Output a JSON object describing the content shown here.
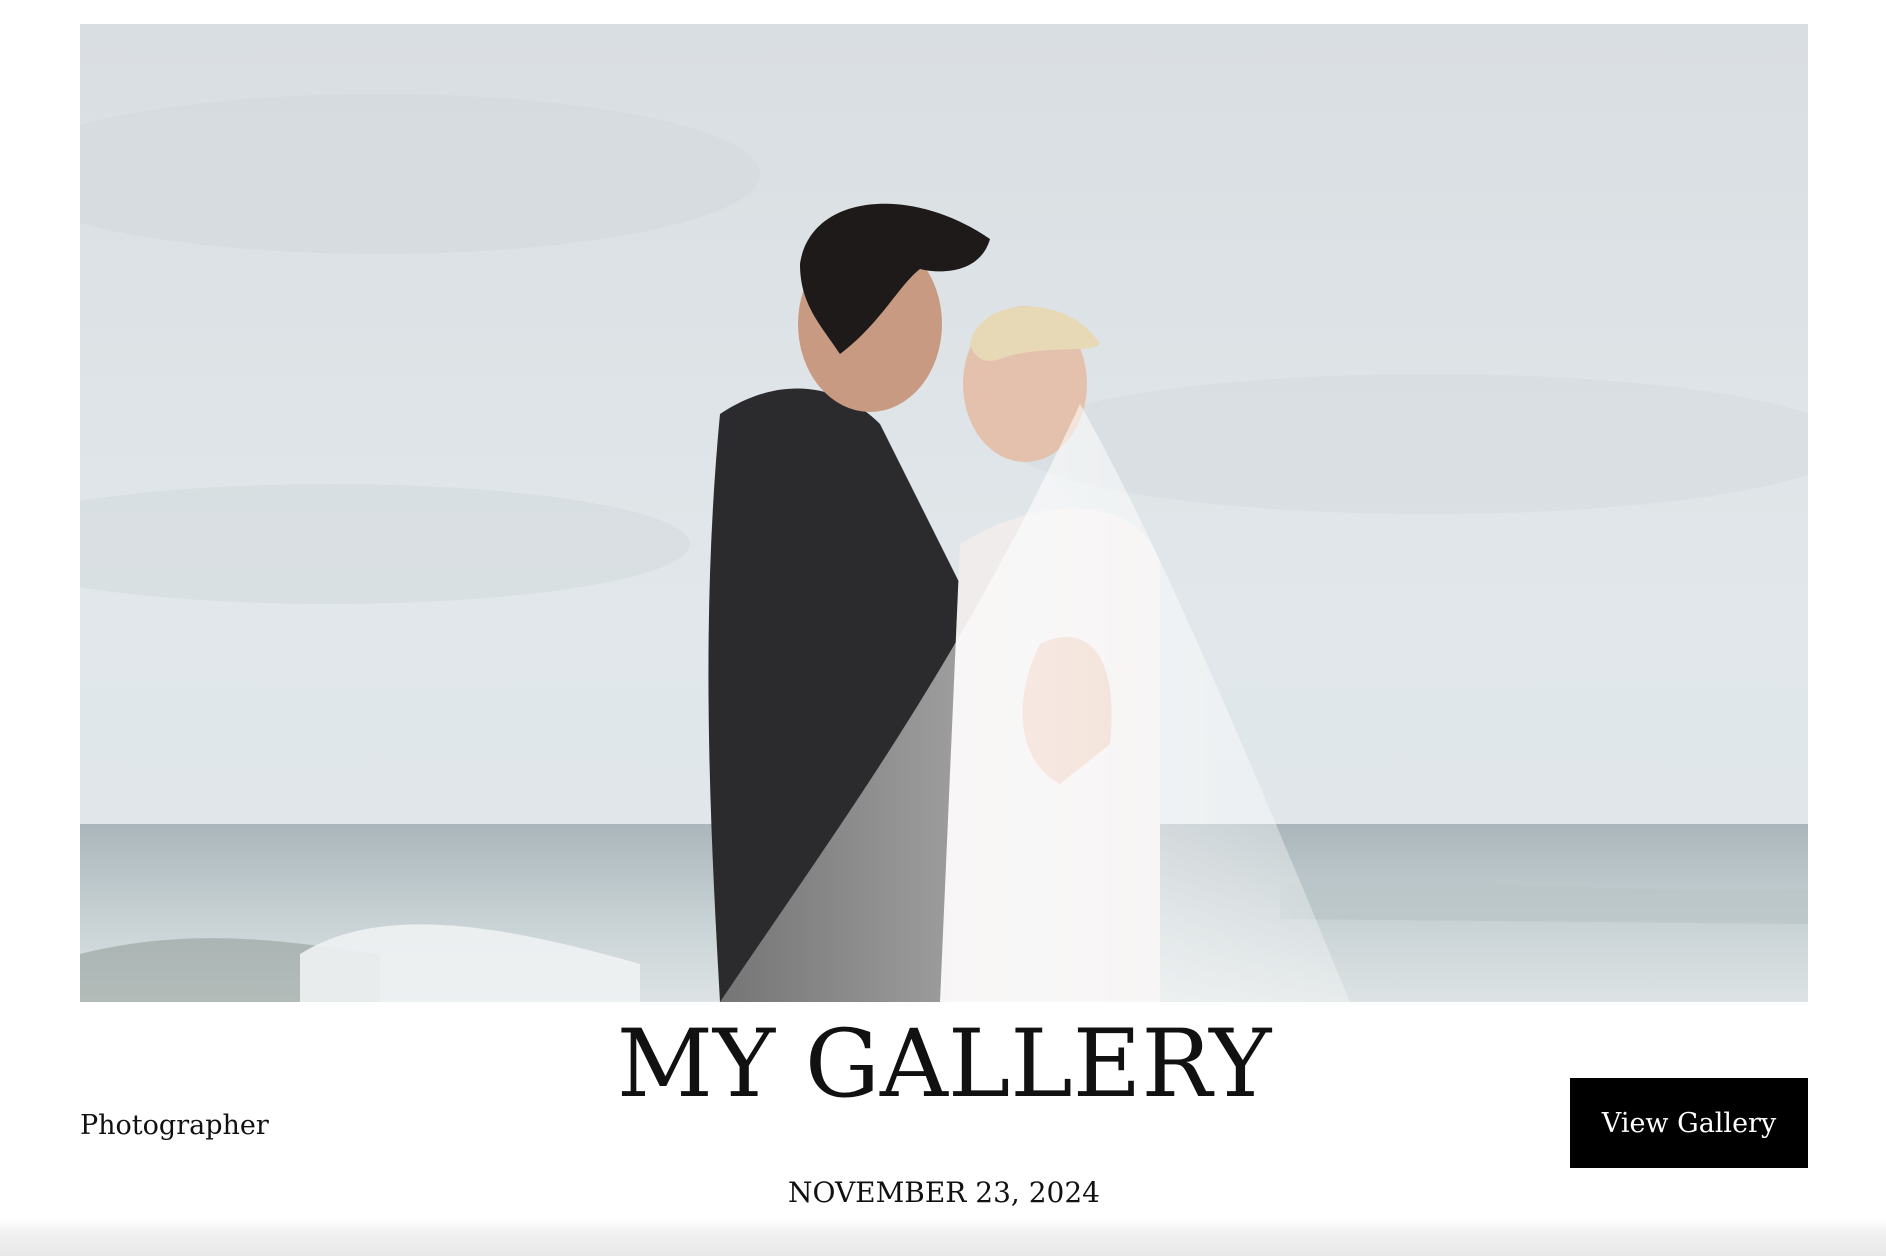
{
  "hero": {
    "image_alt": ""
  },
  "footer": {
    "photographer_label": "Photographer",
    "title": "MY GALLERY",
    "date": "NOVEMBER 23, 2024",
    "view_gallery_label": "View Gallery"
  },
  "colors": {
    "button_background": "#000000",
    "button_text": "#ffffff",
    "page_background": "#ffffff"
  }
}
